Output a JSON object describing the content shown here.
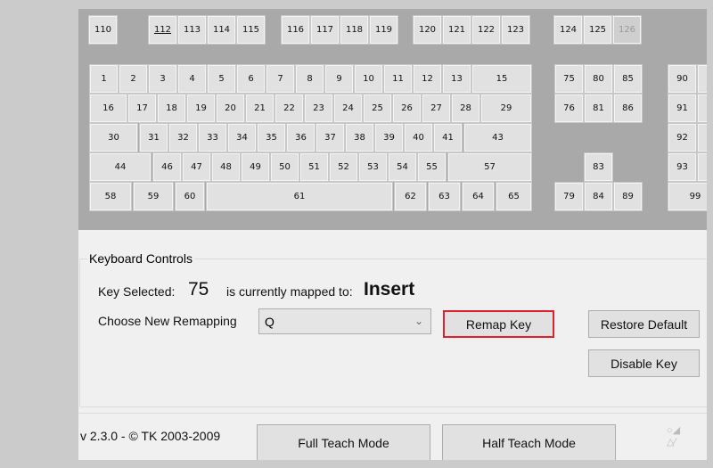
{
  "keyboard": {
    "function_row": [
      "110",
      "112",
      "113",
      "114",
      "115",
      "116",
      "117",
      "118",
      "119",
      "120",
      "121",
      "122",
      "123",
      "124",
      "125",
      "126"
    ],
    "main_rows": [
      [
        "1",
        "2",
        "3",
        "4",
        "5",
        "6",
        "7",
        "8",
        "9",
        "10",
        "11",
        "12",
        "13",
        "15"
      ],
      [
        "16",
        "17",
        "18",
        "19",
        "20",
        "21",
        "22",
        "23",
        "24",
        "25",
        "26",
        "27",
        "28",
        "29"
      ],
      [
        "30",
        "31",
        "32",
        "33",
        "34",
        "35",
        "36",
        "37",
        "38",
        "39",
        "40",
        "41",
        "43"
      ],
      [
        "44",
        "46",
        "47",
        "48",
        "49",
        "50",
        "51",
        "52",
        "53",
        "54",
        "55",
        "57"
      ],
      [
        "58",
        "59",
        "60",
        "61",
        "62",
        "63",
        "64",
        "65"
      ]
    ],
    "nav_keys": [
      "75",
      "80",
      "85",
      "76",
      "81",
      "86",
      "83",
      "79",
      "84",
      "89"
    ],
    "numpad_keys": [
      "90",
      "91",
      "92",
      "93",
      "99"
    ],
    "disabled_key": "126",
    "underlined_key": "112"
  },
  "controls": {
    "group_title": "Keyboard Controls",
    "key_selected_label": "Key Selected:",
    "key_selected_value": "75",
    "mapped_to_label": "is currently mapped to:",
    "mapped_to_value": "Insert",
    "choose_label": "Choose New Remapping",
    "remap_selected": "Q",
    "remap_button": "Remap Key",
    "restore_button": "Restore Default",
    "disable_button": "Disable Key"
  },
  "footer": {
    "version": "v 2.3.0 - © TK 2003-2009",
    "full_teach": "Full Teach Mode",
    "half_teach": "Half Teach Mode"
  },
  "colors": {
    "highlight_border": "#e0202b",
    "keyboard_bg": "#a9a9a9"
  }
}
